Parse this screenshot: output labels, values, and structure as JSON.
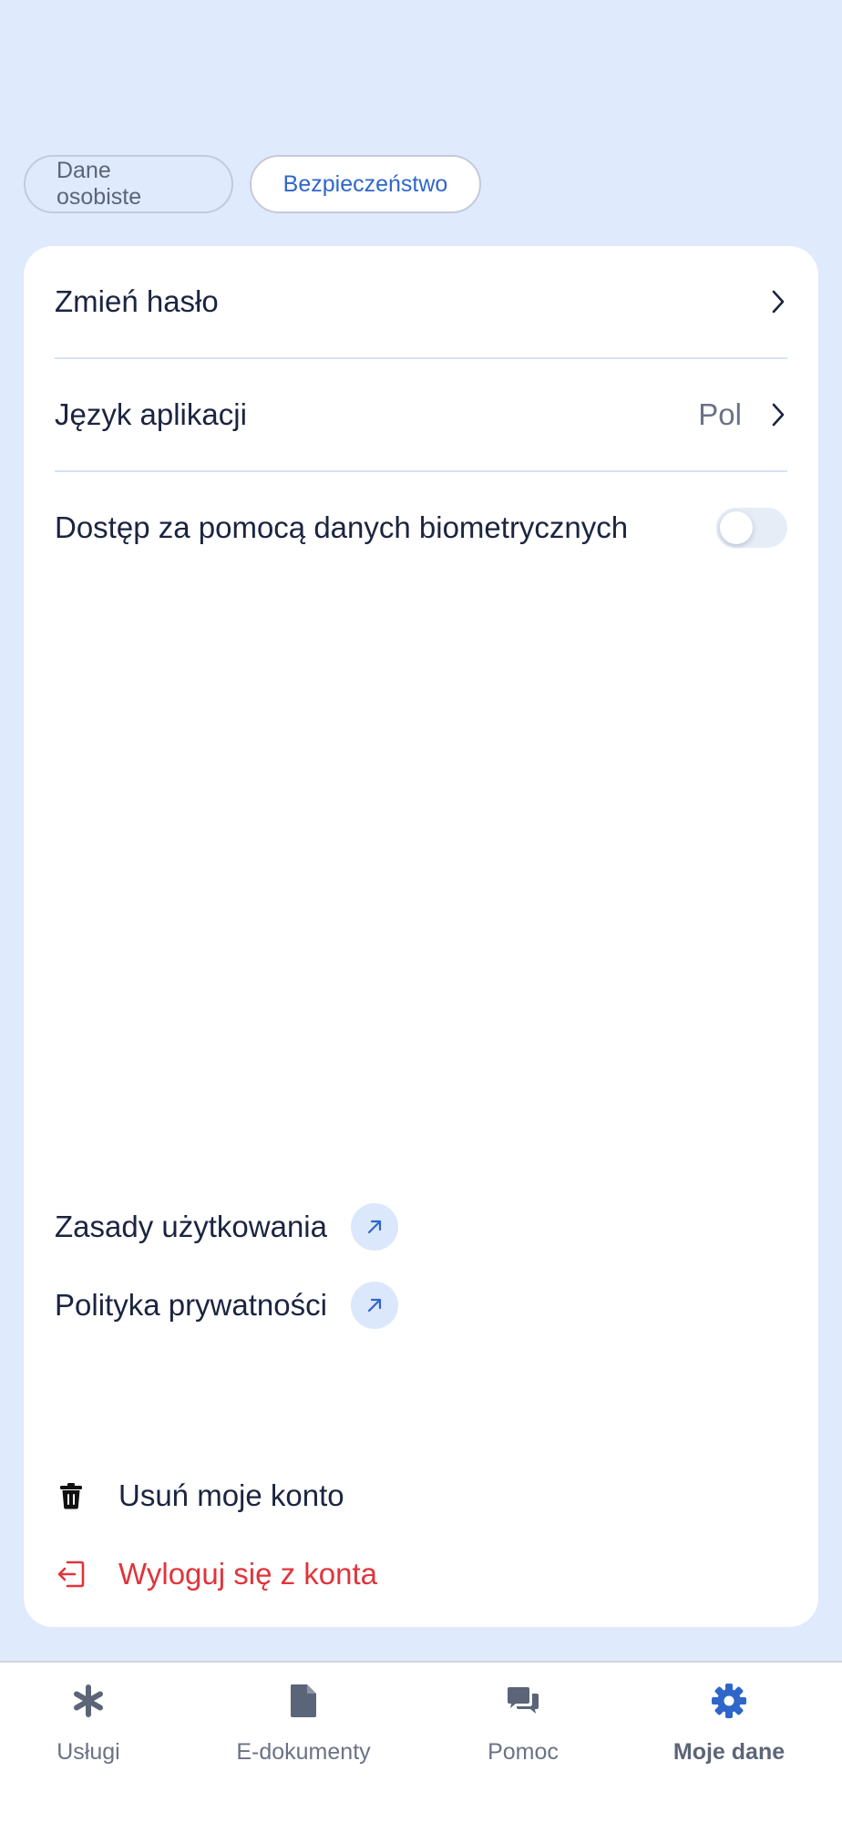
{
  "tabs": [
    {
      "label": "Dane osobiste",
      "active": false
    },
    {
      "label": "Bezpieczeństwo",
      "active": true
    }
  ],
  "settings": {
    "change_password": "Zmień hasło",
    "language_label": "Język aplikacji",
    "language_value": "Pol",
    "biometrics_label": "Dostęp za pomocą danych biometrycznych",
    "biometrics_enabled": false
  },
  "links": {
    "terms": "Zasady użytkowania",
    "privacy": "Polityka prywatności"
  },
  "actions": {
    "delete_account": "Usuń moje konto",
    "logout": "Wyloguj się z konta"
  },
  "bottom_nav": [
    {
      "label": "Usługi",
      "icon": "asterisk-icon",
      "active": false
    },
    {
      "label": "E-dokumenty",
      "icon": "document-icon",
      "active": false
    },
    {
      "label": "Pomoc",
      "icon": "chat-icon",
      "active": false
    },
    {
      "label": "Moje dane",
      "icon": "gear-icon",
      "active": true
    }
  ],
  "colors": {
    "background": "#dfeafd",
    "accent": "#2f66c9",
    "danger": "#e0343c",
    "text": "#1b2440"
  }
}
